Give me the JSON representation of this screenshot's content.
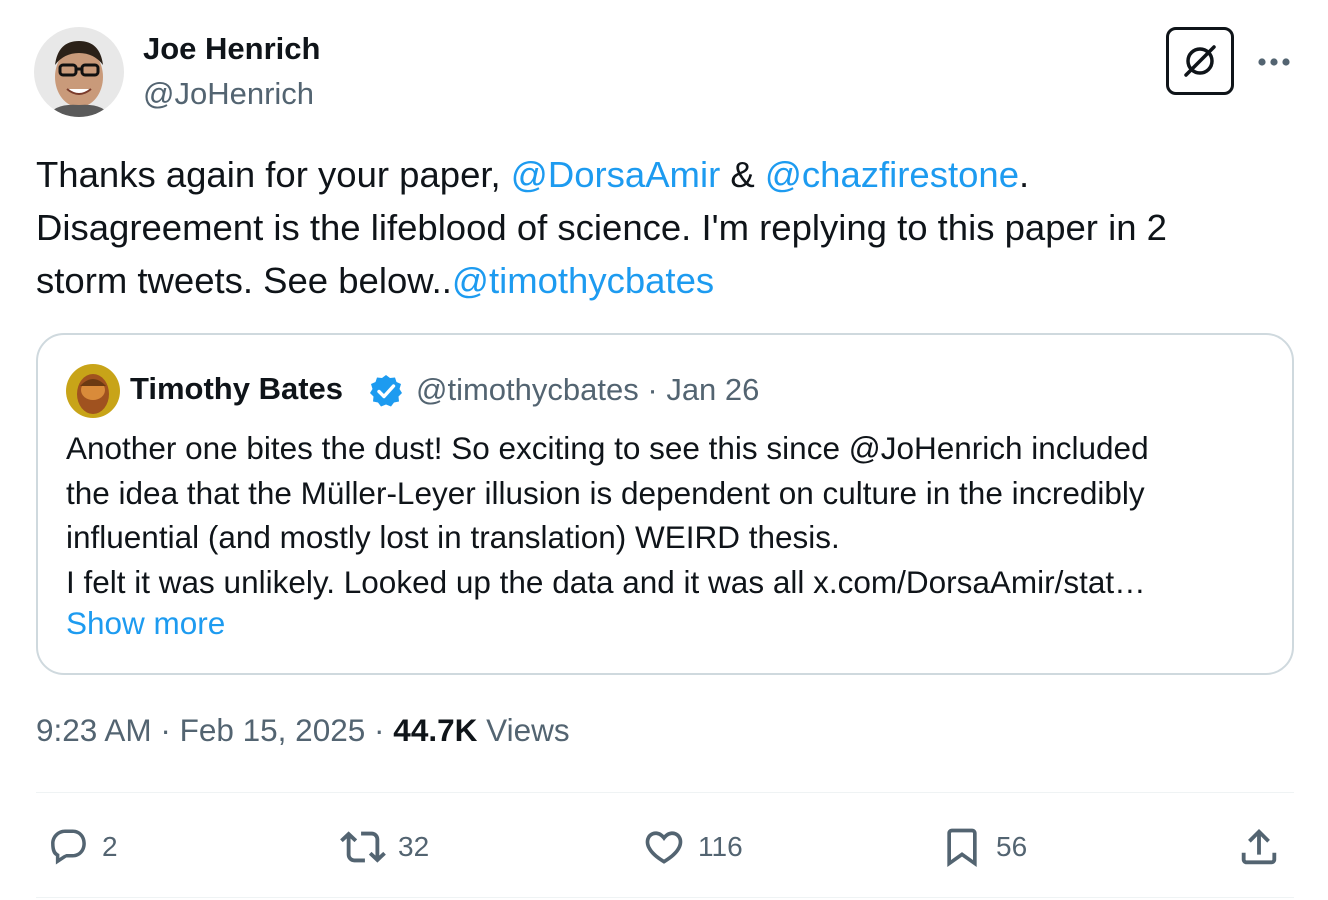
{
  "author": {
    "name": "Joe Henrich",
    "handle": "@JoHenrich"
  },
  "tweet": {
    "segments": {
      "s1": "Thanks again for your paper, ",
      "m1": "@DorsaAmir",
      "s2": " & ",
      "m2": "@chazfirestone",
      "s3": ".",
      "s4": "Disagreement is the lifeblood of science. I'm replying to this paper in 2",
      "s5": "storm tweets. See below..",
      "m3": "@timothycbates"
    }
  },
  "quote": {
    "name": "Timothy Bates",
    "handle": "@timothycbates",
    "separator": "·",
    "date": "Jan 26",
    "lines": [
      "Another one bites the dust! So exciting to see this since @JoHenrich included",
      "the idea that the Müller-Leyer illusion is dependent on culture in the incredibly",
      "influential (and mostly lost in translation) WEIRD thesis.",
      "I felt it was unlikely. Looked up the data and it was all x.com/DorsaAmir/stat…"
    ],
    "show_more": "Show more"
  },
  "meta": {
    "time": "9:23 AM",
    "separator": "·",
    "date": "Feb 15, 2025",
    "views_count": "44.7K",
    "views_label": "Views"
  },
  "actions": {
    "replies": "2",
    "reposts": "32",
    "likes": "116",
    "bookmarks": "56"
  },
  "colors": {
    "accent": "#1d9bf0",
    "text": "#0f1419",
    "secondary": "#536471",
    "border": "#cfd9de"
  }
}
